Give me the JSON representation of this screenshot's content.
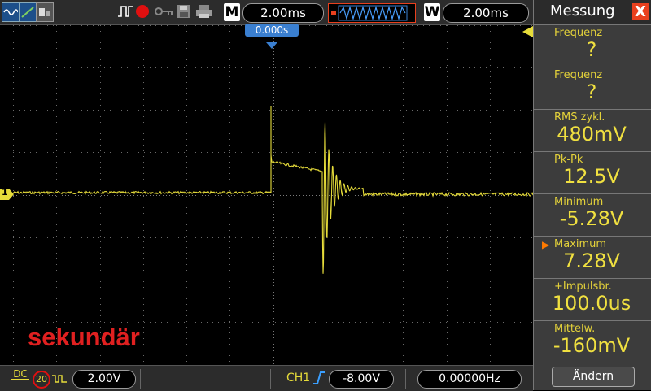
{
  "top_bar": {
    "timebase_label": "M",
    "timebase_value": "2.00ms",
    "window_label": "W",
    "window_value": "2.00ms",
    "trigger_time": "0.000s"
  },
  "waveform": {
    "channel_marker": "1",
    "caption": "sekundär"
  },
  "panel": {
    "title": "Messung",
    "close_glyph": "X",
    "measurements": [
      {
        "label": "Frequenz",
        "value": "?"
      },
      {
        "label": "Frequenz",
        "value": "?"
      },
      {
        "label": "RMS  zykl.",
        "value": "480mV"
      },
      {
        "label": "Pk-Pk",
        "value": "12.5V"
      },
      {
        "label": "Minimum",
        "value": "-5.28V"
      },
      {
        "label": "Maximum",
        "value": "7.28V",
        "selected": true
      },
      {
        "label": "+Impulsbr.",
        "value": "100.0us"
      },
      {
        "label": "Mittelw.",
        "value": "-160mV"
      }
    ],
    "change_button": "Ändern"
  },
  "bottom_bar": {
    "coupling": "DC",
    "bw_limit": "20",
    "ch_scale": "2.00V",
    "trigger_source": "CH1",
    "trigger_level": "-8.00V",
    "trigger_freq": "0.00000Hz"
  },
  "colors": {
    "trace": "#e6dc3a",
    "accent_orange": "#e8401e",
    "caption_red": "#e02020",
    "trigger_blue": "#3a7fd0"
  }
}
